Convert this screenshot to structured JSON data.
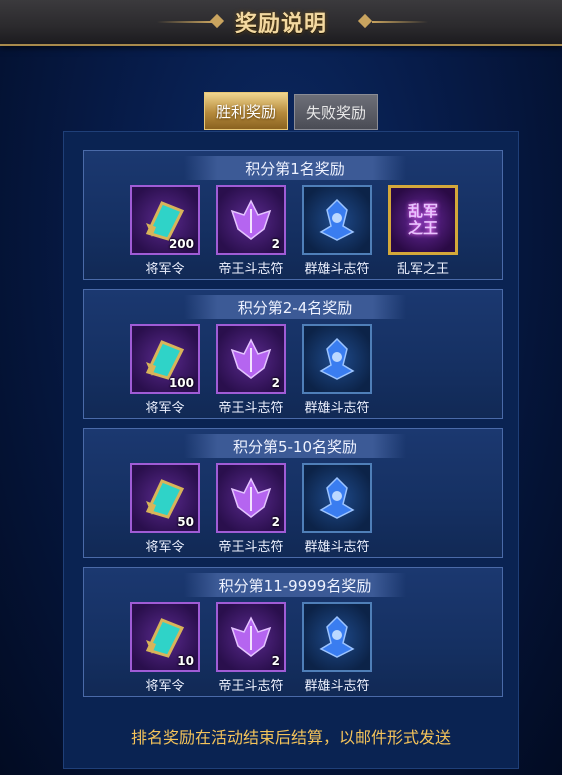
{
  "window": {
    "title": "奖励说明"
  },
  "tabs": [
    {
      "label": "胜利奖励",
      "active": true
    },
    {
      "label": "失败奖励",
      "active": false
    }
  ],
  "groups": [
    {
      "title": "积分第1名奖励",
      "items": [
        {
          "name": "将军令",
          "qty": "200",
          "icon": "general-token-icon",
          "frame": "purple"
        },
        {
          "name": "帝王斗志符",
          "qty": "2",
          "icon": "emperor-talisman-icon",
          "frame": "purple"
        },
        {
          "name": "群雄斗志符",
          "qty": "",
          "icon": "heroes-talisman-icon",
          "frame": "blue"
        },
        {
          "name": "乱军之王",
          "qty": "",
          "icon": "title-emblem-icon",
          "frame": "gold",
          "emblem_text": [
            "乱军",
            "之王"
          ]
        }
      ]
    },
    {
      "title": "积分第2-4名奖励",
      "items": [
        {
          "name": "将军令",
          "qty": "100",
          "icon": "general-token-icon",
          "frame": "purple"
        },
        {
          "name": "帝王斗志符",
          "qty": "2",
          "icon": "emperor-talisman-icon",
          "frame": "purple"
        },
        {
          "name": "群雄斗志符",
          "qty": "",
          "icon": "heroes-talisman-icon",
          "frame": "blue"
        }
      ]
    },
    {
      "title": "积分第5-10名奖励",
      "items": [
        {
          "name": "将军令",
          "qty": "50",
          "icon": "general-token-icon",
          "frame": "purple"
        },
        {
          "name": "帝王斗志符",
          "qty": "2",
          "icon": "emperor-talisman-icon",
          "frame": "purple"
        },
        {
          "name": "群雄斗志符",
          "qty": "",
          "icon": "heroes-talisman-icon",
          "frame": "blue"
        }
      ]
    },
    {
      "title": "积分第11-9999名奖励",
      "items": [
        {
          "name": "将军令",
          "qty": "10",
          "icon": "general-token-icon",
          "frame": "purple"
        },
        {
          "name": "帝王斗志符",
          "qty": "2",
          "icon": "emperor-talisman-icon",
          "frame": "purple"
        },
        {
          "name": "群雄斗志符",
          "qty": "",
          "icon": "heroes-talisman-icon",
          "frame": "blue"
        }
      ]
    }
  ],
  "footer": {
    "note": "排名奖励在活动结束后结算，以邮件形式发送"
  },
  "colors": {
    "accent_gold": "#f4c35a",
    "tab_active": "#b58a3c",
    "panel_bg": "#0a2352"
  }
}
